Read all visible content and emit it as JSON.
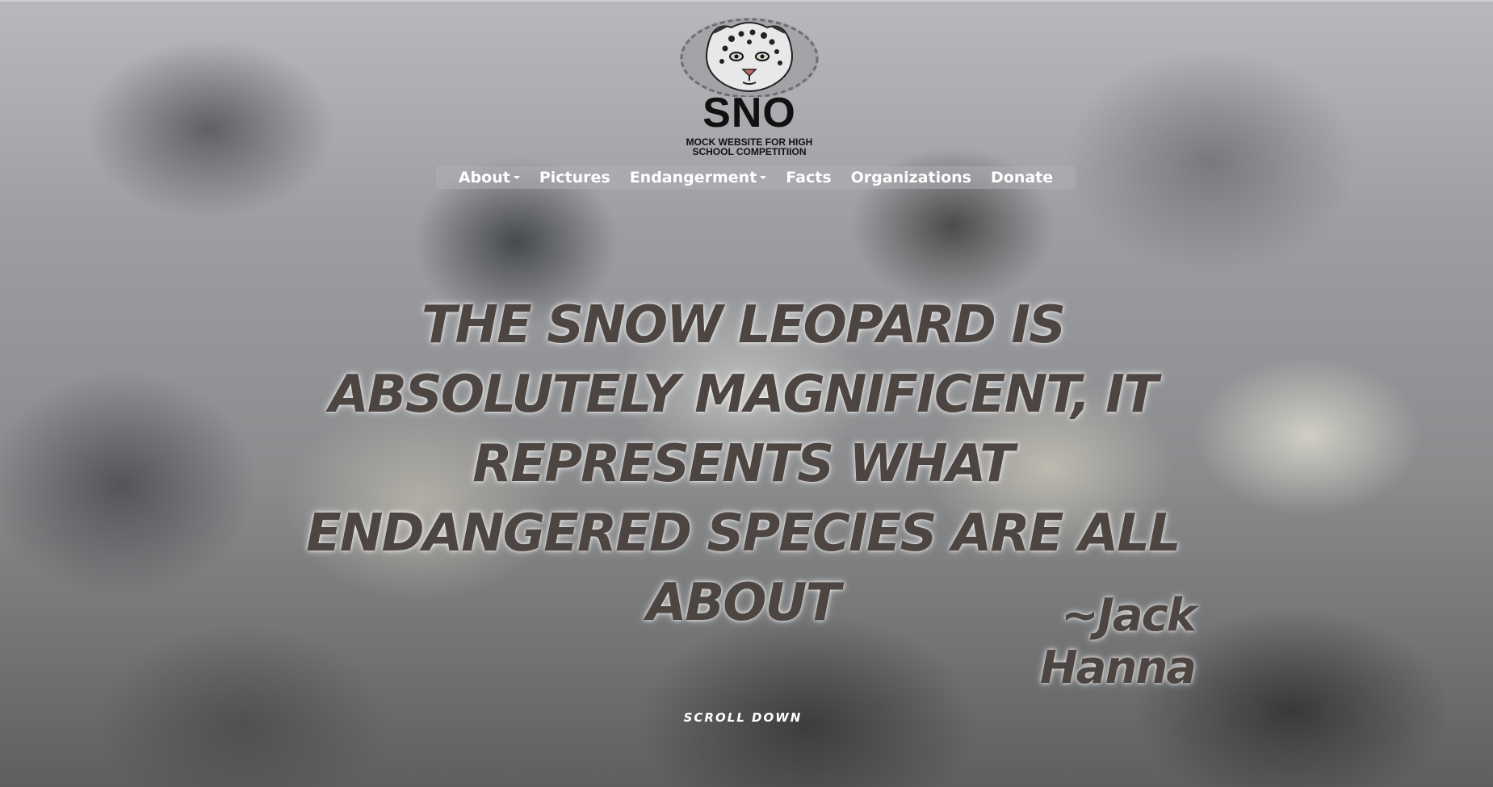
{
  "logo": {
    "title": "SNO",
    "subtitle": "MOCK WEBSITE FOR HIGH SCHOOL COMPETITIION"
  },
  "nav": {
    "items": [
      {
        "label": "About",
        "dropdown": true
      },
      {
        "label": "Pictures",
        "dropdown": false
      },
      {
        "label": "Endangerment",
        "dropdown": true
      },
      {
        "label": "Facts",
        "dropdown": false
      },
      {
        "label": "Organizations",
        "dropdown": false
      },
      {
        "label": "Donate",
        "dropdown": false
      }
    ]
  },
  "hero": {
    "quote": "THE SNOW LEOPARD IS ABSOLUTELY MAGNIFICENT, IT REPRESENTS WHAT ENDANGERED SPECIES ARE ALL ABOUT",
    "author": "~Jack Hanna",
    "scroll_label": "SCROLL DOWN"
  },
  "colors": {
    "quote_text": "#4d4541",
    "nav_text": "#ffffff",
    "nav_bar": "#afafb4"
  }
}
